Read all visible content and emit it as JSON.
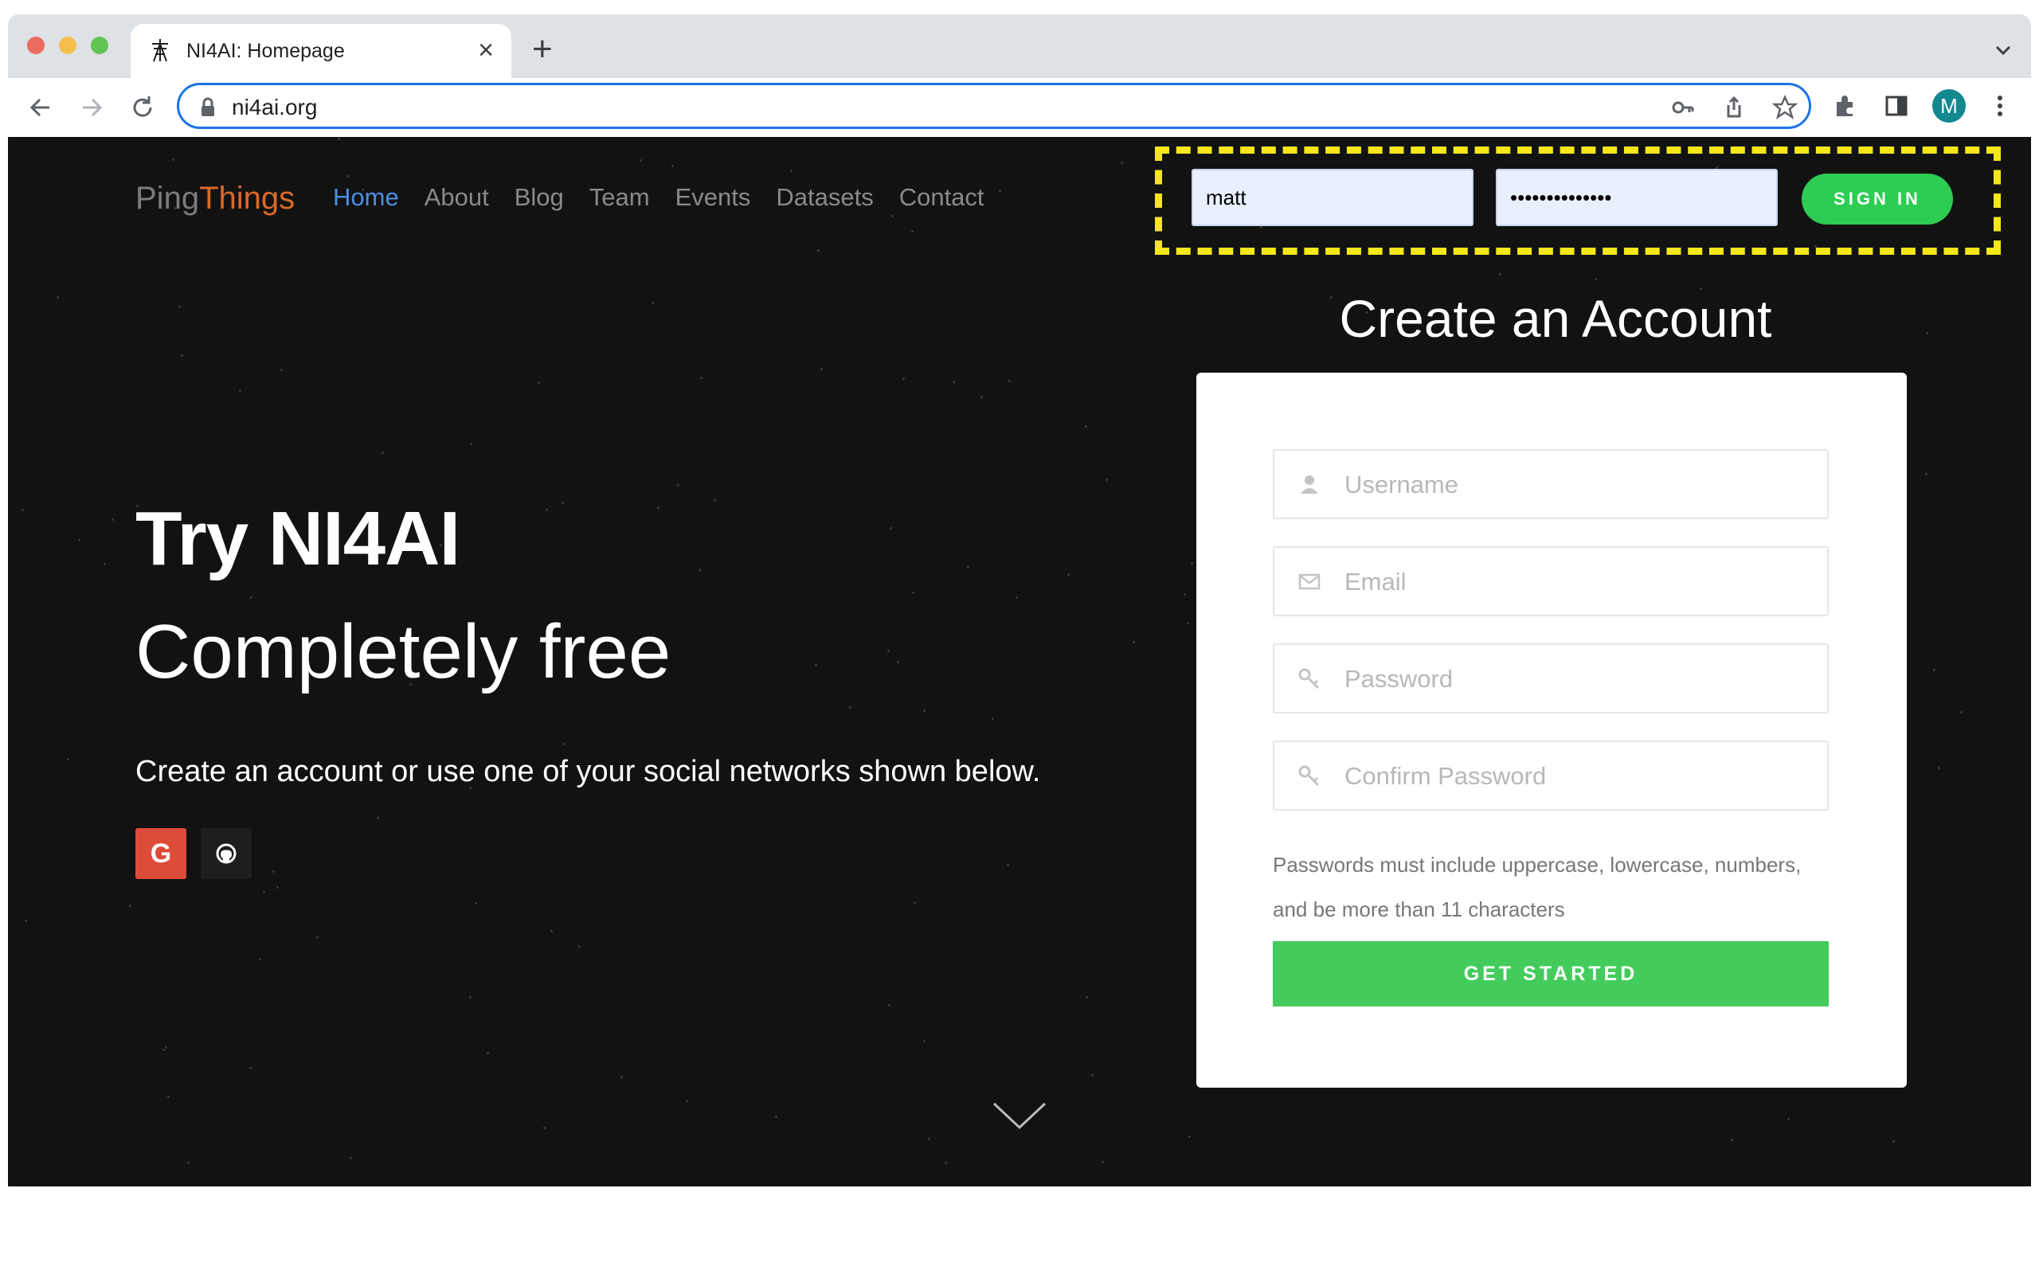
{
  "browser": {
    "tab_title": "NI4AI: Homepage",
    "url": "ni4ai.org",
    "profile_initial": "M",
    "colors": {
      "accent": "#1a73e8",
      "avatar": "#13888f"
    }
  },
  "header": {
    "logo_part1": "Ping",
    "logo_part2": "Things",
    "nav": [
      "Home",
      "About",
      "Blog",
      "Team",
      "Events",
      "Datasets",
      "Contact"
    ],
    "active_nav": "Home"
  },
  "login": {
    "username_value": "matt",
    "password_value": "••••••••••••••",
    "signin_label": "SIGN IN"
  },
  "hero": {
    "title": "Try NI4AI",
    "subtitle": "Completely free",
    "text": "Create an account or use one of your social networks shown below.",
    "google_label": "G"
  },
  "signup": {
    "title": "Create an Account",
    "username_placeholder": "Username",
    "email_placeholder": "Email",
    "password_placeholder": "Password",
    "confirm_placeholder": "Confirm Password",
    "hint": "Passwords must include uppercase, lowercase, numbers, and be more than 11 characters",
    "submit_label": "GET STARTED"
  }
}
